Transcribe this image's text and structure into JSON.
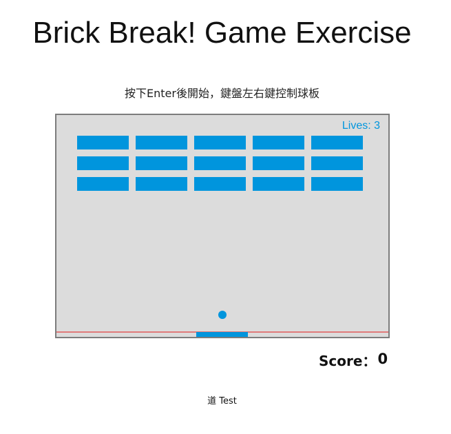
{
  "page": {
    "title": "Brick Break! Game Exercise",
    "instructions": "按下Enter後開始，鍵盤左右鍵控制球板",
    "footer": "道 Test"
  },
  "game": {
    "lives_label": "Lives: 3",
    "lives": 3,
    "score_label": "Score：",
    "score": "0",
    "brick_rows": 3,
    "brick_columns": 5,
    "colors": {
      "background": "#dcdcdc",
      "border": "#7c7c7c",
      "brick": "#0095dd",
      "ball": "#0095dd",
      "paddle": "#0095dd",
      "baseline": "#e07a7a",
      "lives_text": "#0095dd"
    }
  }
}
